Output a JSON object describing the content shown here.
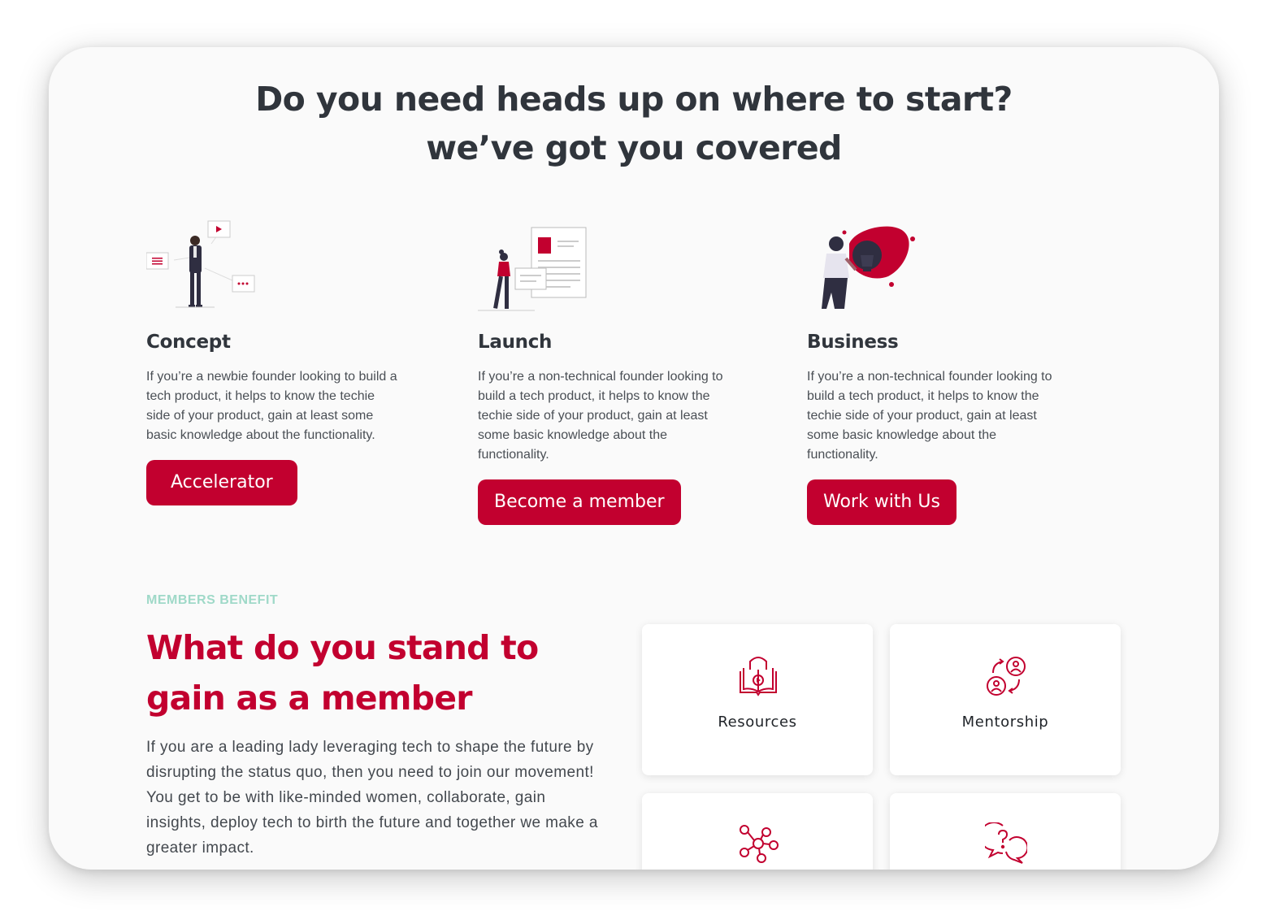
{
  "hero": {
    "title_line1": "Do you need heads up on where to start?",
    "title_line2": "we’ve got you covered"
  },
  "columns": [
    {
      "title": "Concept",
      "text": "If you’re a newbie founder looking to build a tech product, it helps to know the techie side of your product, gain at least some basic knowledge about the functionality.",
      "button": "Accelerator"
    },
    {
      "title": "Launch",
      "text": "If you’re a non-technical founder looking to build a tech product, it helps to know the techie side of your product, gain at least some basic knowledge about the functionality.",
      "button": "Become a member"
    },
    {
      "title": "Business",
      "text": "If you’re a non-technical founder looking to build a tech product, it helps to know the techie side of your product, gain at least some basic knowledge about the functionality.",
      "button": "Work with Us"
    }
  ],
  "benefits": {
    "eyebrow": "MEMBERS BENEFIT",
    "title": "What do you stand to gain as a member",
    "text": "If you are a leading lady leveraging tech to shape the future by disrupting the status quo, then you need to join our movement! You get to be  with like-minded women, collaborate, gain insights, deploy tech to birth the future and together we make a greater impact.",
    "cards": [
      {
        "label": "Resources",
        "icon": "book-video-icon"
      },
      {
        "label": "Mentorship",
        "icon": "mentorship-icon"
      },
      {
        "label": "",
        "icon": "network-icon"
      },
      {
        "label": "",
        "icon": "question-chat-icon"
      }
    ]
  },
  "colors": {
    "accent": "#c2002f",
    "eyebrow": "#9fd9c8",
    "heading": "#30353c",
    "background": "#fafafa"
  }
}
